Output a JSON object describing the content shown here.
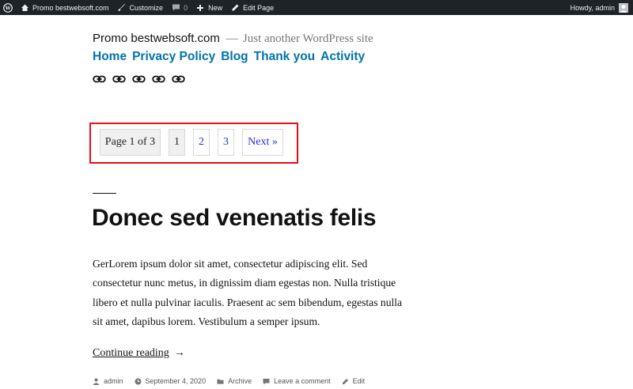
{
  "admin_bar": {
    "site_name": "Promo bestwebsoft.com",
    "customize": "Customize",
    "comments_count": "0",
    "new": "New",
    "edit_page": "Edit Page",
    "greeting": "Howdy, admin"
  },
  "header": {
    "site_title": "Promo bestwebsoft.com",
    "dash": "—",
    "tagline": "Just another WordPress site"
  },
  "nav": [
    "Home",
    "Privacy Policy",
    "Blog",
    "Thank you",
    "Activity"
  ],
  "social_icons": [
    "link-icon",
    "link-icon",
    "link-icon",
    "link-icon",
    "link-icon"
  ],
  "pagination": {
    "info": "Page 1 of 3",
    "current": "1",
    "pages": [
      "2",
      "3"
    ],
    "next": "Next »"
  },
  "post": {
    "title": "Donec sed venenatis felis",
    "content": "GerLorem ipsum dolor sit amet, consectetur adipiscing elit. Sed consectetur nunc metus, in dignissim diam egestas non. Nulla tristique libero et nulla pulvinar iaculis. Praesent ac sem bibendum, egestas nulla sit amet, dapibus lorem. Vestibulum a semper ipsum.",
    "continue": "Continue reading",
    "arrow": "→",
    "meta": {
      "author": "admin",
      "date": "September 4, 2020",
      "category": "Archive",
      "comment": "Leave a comment",
      "edit": "Edit"
    }
  },
  "colors": {
    "link": "#0073aa",
    "pager_link": "#2a2ae0",
    "highlight_box": "#e2101a",
    "admin_bar": "#1d2327"
  }
}
